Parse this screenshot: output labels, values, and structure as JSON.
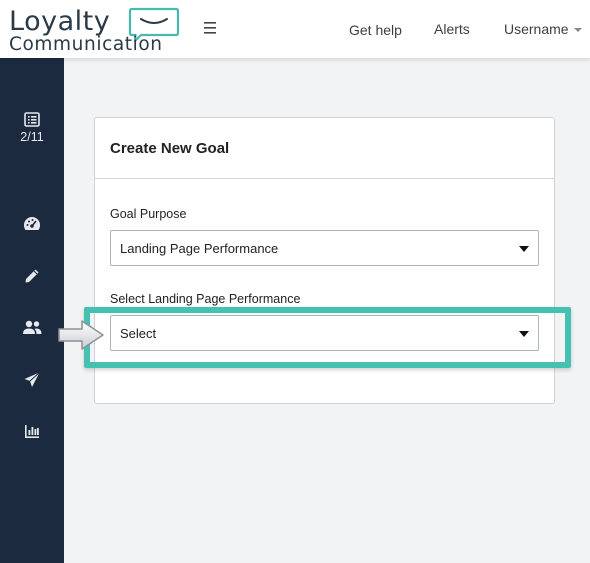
{
  "brand": {
    "line1": "Loyalty",
    "line2": "Communication",
    "accent_color": "#4ab9ad",
    "text_color": "#2b3a47"
  },
  "topbar": {
    "menu_icon": "hamburger-icon",
    "links": [
      "Get help",
      "Alerts"
    ],
    "user_menu": "Username"
  },
  "sidebar": {
    "background": "#1c2a3f",
    "items": [
      {
        "icon": "list-icon",
        "label": "2/11"
      },
      {
        "icon": "dashboard-gauge-icon"
      },
      {
        "icon": "pencil-icon"
      },
      {
        "icon": "users-icon"
      },
      {
        "icon": "paper-plane-icon"
      },
      {
        "icon": "bar-chart-icon"
      }
    ]
  },
  "card": {
    "title": "Create New Goal",
    "fields": [
      {
        "label": "Goal Purpose",
        "value": "Landing Page Performance"
      },
      {
        "label": "Select Landing Page Performance",
        "value": "Select"
      }
    ]
  },
  "annotation": {
    "highlight_color": "#44c1b2",
    "pointer": "arrow-pointer-icon"
  }
}
